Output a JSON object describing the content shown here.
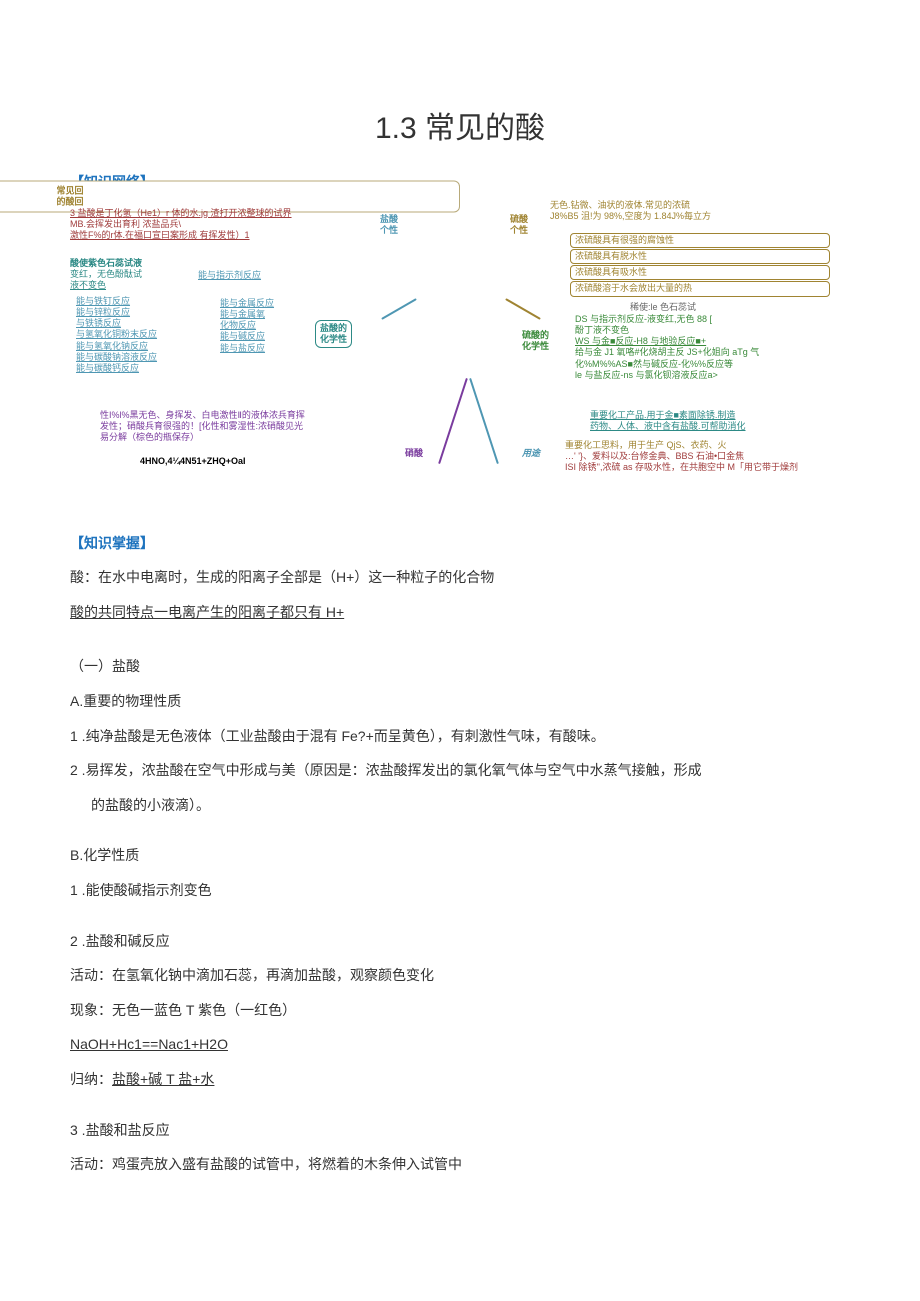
{
  "title": "1.3 常见的酸",
  "section_network": "【知识网络】",
  "section_grasp": "【知识掌握】",
  "mindmap": {
    "center": "常见回\n的酸回",
    "hcl_group_label": "盐酸\n个性",
    "hcl_group_lines": [
      "3 盐酸是丁化氢（He1）r 体的水.jg 渣打开浓整球的试界",
      "MB.会挥发出育利              浓盐品兵\\",
      "激性F%的r体.在福口宣曰案形成        有挥发性）1"
    ],
    "hcl_indicator_head": "酸使紫色石蕊试液",
    "hcl_indicator_lines": [
      "变红，无色酚酞试",
      "液不变色"
    ],
    "hcl_indicator_branch": "能与指示剂反应",
    "hcl_chem_label": "盐酸的\n化学性",
    "hcl_chem_items": [
      "能与铁钉反应",
      "能与锌粒反应",
      "与铁锈反应",
      "与氢氧化铜粉末反应",
      "能与氢氧化钠反应",
      "能与碳酸钠溶液反应",
      "能与碳酸钙反应"
    ],
    "hcl_chem_right_items": [
      "能与金属反应",
      "能与金属氧\n化物反应",
      "能与碱反应",
      "能与盐反应"
    ],
    "hno3_label": "硝酸",
    "hno3_lines": [
      "性I%l%黑无色、身挥发、白电激性Ⅱ的液体浓兵育挥",
      "发性；硝酸兵育很强的！[化性和雾湿性:浓硝酸见光",
      "易分解（棕色的瓶保存）"
    ],
    "hno3_formula": "4HNO,4¼4N51+ZHQ+OaI",
    "h2so4_group_label": "硫酸\n个性",
    "h2so4_group_lines": [
      "无色.钻微、油状的液体.常见的浓硫",
      "J8%B5 沮!为 98%,空度为 1.84J%毎立方"
    ],
    "h2so4_props": [
      "浓硫酸具有很强的腐蚀性",
      "浓硫酸具有脱水性",
      "浓硫酸具有吸水性",
      "浓硫酸溶于水会放出大量的热"
    ],
    "h2so4_chem_label": "硫酸的\n化学性",
    "h2so4_indicator_head": "稀使:le 色石蕊试",
    "h2so4_chem_items": [
      "DS 与指示剂反应-液变红,无色 88        [",
      "酚丁液不变色",
      "WS 与金■反应-H8 与地验反应■+",
      "给与金 J1 氧咯#化烧胡主反 JS+化姐向 aTg 气",
      "化%M%%AS■然与碱反应-化%%反应等",
      "le 与盐反应-ns 与氯化钡溶液反应a>"
    ],
    "uses_label": "用途",
    "uses_hcl": [
      "重要化工产品.用于金■素面除锈.制造",
      "药物、人体、液中含有盐酸.可帮助消化"
    ],
    "uses_h2so4": [
      "重要化工思料，用于生产 QjS、衣药、火",
      "…' '}、爱料以及:台修金典、BBS 石油•口金焦",
      "ISI 除锈'',浓硫 as 存吸水性，在共胞空中 M「用它带于燥剂"
    ]
  },
  "body": {
    "acid_def": "酸：在水中电离时，生成的阳离子全部是（H+）这一种粒子的化合物",
    "acid_common": "酸的共同特点一电离产生的阳离子都只有 H+",
    "sec1_title": "（一）盐酸",
    "phys_head": "A.重要的物理性质",
    "phys_1": "1 .纯净盐酸是无色液体（工业盐酸由于混有 Fe?+而呈黄色），有刺激性气味，有酸味。",
    "phys_2a": "2   .易挥发，浓盐酸在空气中形成与美（原因是：浓盐酸挥发出的氯化氧气体与空气中水蒸气接触，形成",
    "phys_2b": "的盐酸的小液滴）。",
    "chem_head": "B.化学性质",
    "chem_1": "1 .能使酸碱指示剂变色",
    "chem_2": "2   .盐酸和碱反应",
    "chem_2_act": "活动：在氢氧化钠中滴加石蕊，再滴加盐酸，观察颜色变化",
    "chem_2_phen": "现象：无色一蓝色 T 紫色（一红色）",
    "chem_2_eq": "NaOH+Hc1==Nac1+H2O",
    "chem_2_sum_pre": "归纳：",
    "chem_2_sum": "盐酸+碱 T 盐+水",
    "chem_3": "3   .盐酸和盐反应",
    "chem_3_act": "活动：鸡蛋壳放入盛有盐酸的试管中，将燃着的木条伸入试管中"
  }
}
